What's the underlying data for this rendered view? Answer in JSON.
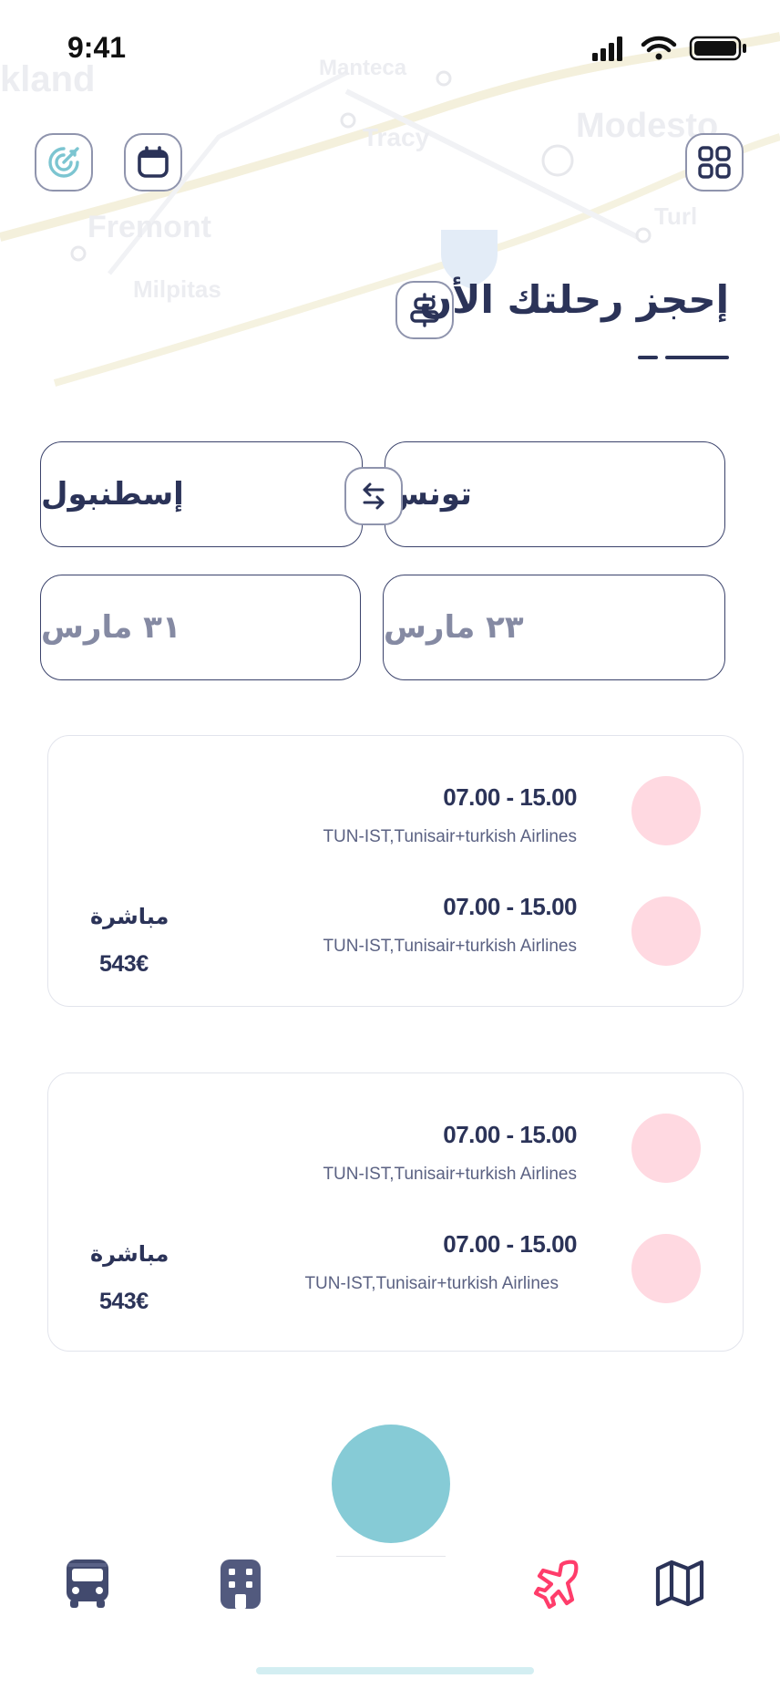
{
  "status_bar": {
    "time": "9:41"
  },
  "header": {
    "title": "إحجز رحلتك الأن"
  },
  "search": {
    "from_city": "تونس",
    "to_city": "إسطنبول",
    "depart_date": "٢٣ مارس",
    "return_date": "٣١ مارس"
  },
  "results": [
    {
      "legs": [
        {
          "time": "07.00 - 15.00",
          "route": "TUN-IST,Tunisair+turkish Airlines"
        },
        {
          "time": "07.00 - 15.00",
          "route": "TUN-IST,Tunisair+turkish Airlines"
        }
      ],
      "stop_type": "مباشرة",
      "price": "543€"
    },
    {
      "legs": [
        {
          "time": "07.00 - 15.00",
          "route": "TUN-IST,Tunisair+turkish Airlines"
        },
        {
          "time": "07.00 - 15.00",
          "route": "TUN-IST,Tunisair+turkish Airlines"
        }
      ],
      "stop_type": "مباشرة",
      "price": "543€"
    }
  ],
  "map_labels": [
    "kland",
    "Manteca",
    "Tracy",
    "Modesto",
    "Fremont",
    "Milpitas",
    "Turl"
  ],
  "icons": {
    "target": "target-icon",
    "calendar": "calendar-icon",
    "grid": "grid-icon",
    "filter": "align-icon",
    "swap": "swap-icon",
    "bus": "bus-icon",
    "hotel": "building-icon",
    "plane": "plane-icon",
    "map": "map-icon"
  },
  "colors": {
    "primary": "#2b3358",
    "accent_teal": "#86cbd6",
    "accent_pink": "#ff3d6b",
    "airline_dot": "#ffd9e1"
  }
}
